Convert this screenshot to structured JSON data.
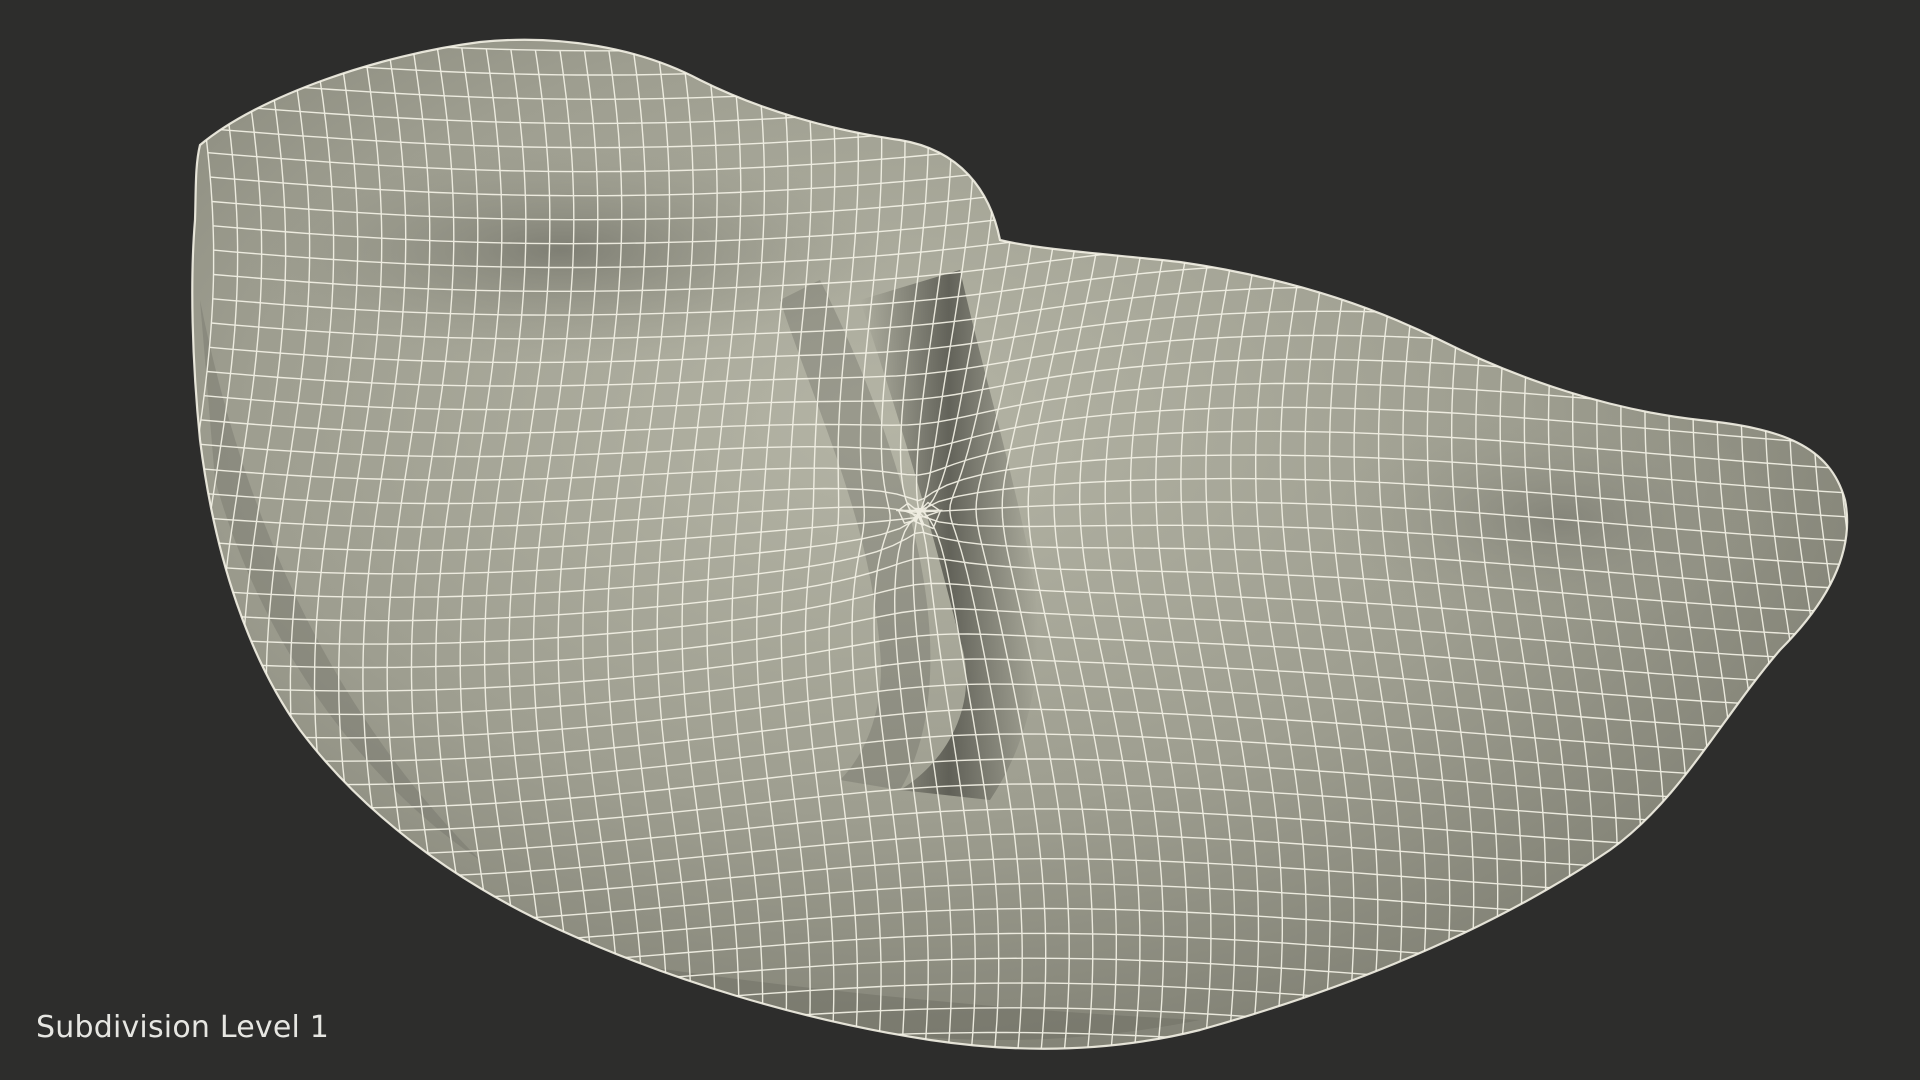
{
  "caption": "Subdivision Level 1",
  "colors": {
    "background": "#2d2d2c",
    "surface_light": "#aeae9f",
    "surface_mid": "#8e8e81",
    "surface_dark": "#5f5f56",
    "wireframe": "#f4f2e6",
    "caption": "#e6e6e2"
  }
}
